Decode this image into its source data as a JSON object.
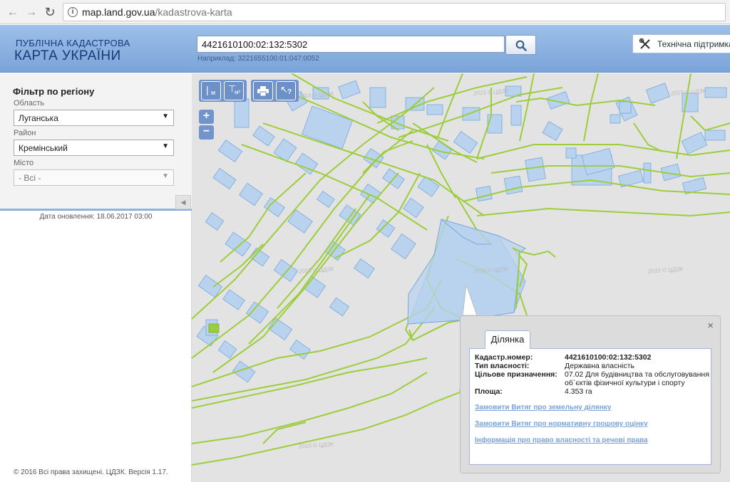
{
  "browser": {
    "url_host": "map.land.gov.ua",
    "url_path": "/kadastrova-karta"
  },
  "header": {
    "logo_line1": "ПУБЛІЧНА КАДАСТРОВА",
    "logo_line2": "КАРТА УКРАЇНИ",
    "search_value": "4421610100:02:132:5302",
    "search_example": "Наприклад: 3221655100:01:047:0052",
    "support_label": "Технічна підтримка"
  },
  "sidebar": {
    "filter_title": "Фільтр по регіону",
    "region_label": "Область",
    "region_value": "Луганська",
    "district_label": "Район",
    "district_value": "Кремінський",
    "city_label": "Місто",
    "city_value": "- Всі -",
    "updated": "Дата оновлення: 18.06.2017 03:00",
    "copyright": "© 2016 Всі права захищені. ЦДЗК. Версія 1.17."
  },
  "map": {
    "watermark": "2015 © ЦДЗК",
    "tools": {
      "measure_length": "м",
      "measure_area": "м²",
      "print": "print-icon",
      "identify": "?"
    },
    "zoom_in": "+",
    "zoom_out": "−",
    "colors": {
      "background": "#e4e3e3",
      "parcel_border": "#9ccd3a",
      "building_fill": "#b9d3ee",
      "building_stroke": "#77a8dc"
    }
  },
  "popup": {
    "tab": "Ділянка",
    "close": "×",
    "rows": [
      {
        "key": "Кадастр.номер:",
        "value": "4421610100:02:132:5302"
      },
      {
        "key": "Тип власності:",
        "value": "Державна власність"
      },
      {
        "key": "Цільове призначення:",
        "value": "07.02 Для будівництва та обслуговування об`єктів фізичної культури і спорту"
      },
      {
        "key": "Площа:",
        "value": "4.353 га"
      }
    ],
    "links": [
      "Замовити Витяг про земельну ділянку",
      "Замовити Витяг про нормативну грошову оцінку",
      "Інформація про право власності та речові права"
    ]
  }
}
